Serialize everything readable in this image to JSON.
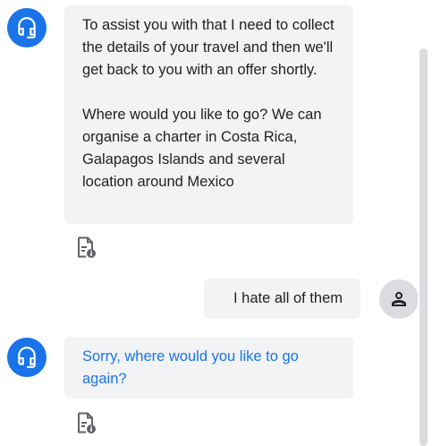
{
  "conversation": {
    "messages": [
      {
        "role": "agent",
        "paragraphs": [
          "To assist you with that I need to collect the details of your travel and then we'll get back to you with an offer shortly.",
          "Where would you like to go? We can organise a charter in Costa Rica, Galapagos Islands and several location around Mexico"
        ],
        "icon": "headset-icon"
      },
      {
        "role": "user",
        "text": "I hate all of them",
        "icon": "person-icon"
      },
      {
        "role": "agent",
        "paragraphs": [
          "Sorry, where would you like to go again?"
        ],
        "icon": "headset-icon"
      }
    ],
    "message_action_icon": "document-info-icon"
  },
  "colors": {
    "agent_avatar": "#1a73e8",
    "user_avatar": "#dadce0",
    "bubble": "#f1f3f4",
    "link_text": "#1a73e8",
    "scrollbar_thumb": "#dadce0"
  }
}
